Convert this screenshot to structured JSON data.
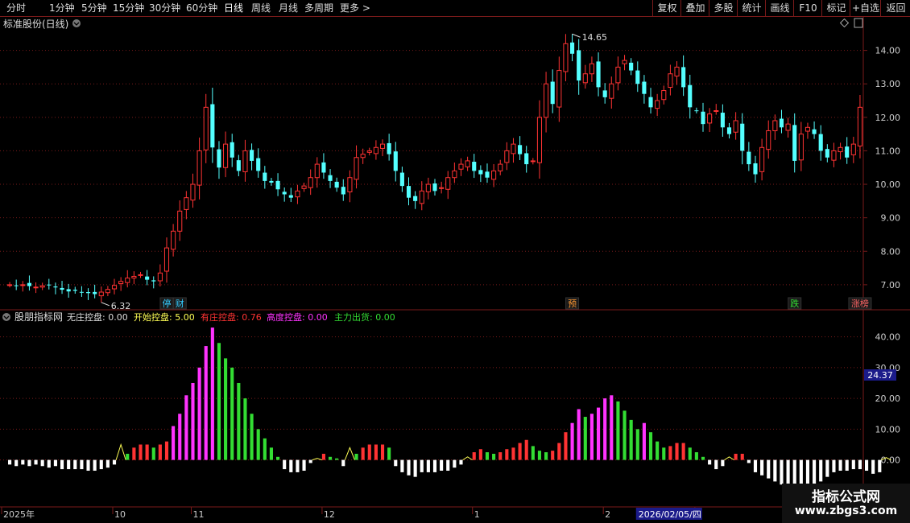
{
  "toolbar": {
    "periods": [
      "分时",
      "1分钟",
      "5分钟",
      "15分钟",
      "30分钟",
      "60分钟",
      "日线",
      "周线",
      "月线",
      "多周期",
      "更多 >"
    ],
    "active_period": "日线",
    "right_buttons": [
      "复权",
      "叠加",
      "多股",
      "统计",
      "画线",
      "F10",
      "标记",
      "+自选",
      "返回"
    ]
  },
  "main_panel": {
    "title": "标准股份(日线)",
    "high_label": "14.65",
    "low_label": "6.32",
    "markers": [
      {
        "idx": 24,
        "text": "停",
        "color": "#33ccff"
      },
      {
        "idx": 26,
        "text": "财",
        "color": "#33ccff"
      },
      {
        "idx": 86,
        "text": "预",
        "color": "#ff9933"
      },
      {
        "idx": 120,
        "text": "跌",
        "color": "#33dd33"
      },
      {
        "idx": 130,
        "text": "涨榜",
        "color": "#ff6666"
      }
    ]
  },
  "indicator_panel": {
    "title": "股朋指标网",
    "fields": [
      {
        "label": "无庄控盘: 0.00",
        "color": "#dddddd"
      },
      {
        "label": "开始控盘: 5.00",
        "color": "#ffff55"
      },
      {
        "label": "有庄控盘: 0.76",
        "color": "#ff3333"
      },
      {
        "label": "高度控盘: 0.00",
        "color": "#ff33ff"
      },
      {
        "label": "主力出货: 0.00",
        "color": "#33dd33"
      }
    ],
    "cursor_value": "24.37"
  },
  "time_axis": {
    "labels": [
      {
        "idx": 0,
        "text": "2025年"
      },
      {
        "idx": 16,
        "text": "10"
      },
      {
        "idx": 28,
        "text": "11"
      },
      {
        "idx": 48,
        "text": "12"
      },
      {
        "idx": 71,
        "text": "1"
      },
      {
        "idx": 91,
        "text": "2"
      },
      {
        "idx": 105,
        "text": "3"
      }
    ],
    "cursor_date": "2026/02/05/四",
    "cursor_idx": 96
  },
  "watermark": {
    "line1": "指标公式网",
    "line2": "www.zbgs3.com"
  },
  "colors": {
    "up": "#ff3333",
    "down": "#54ffff",
    "grid": "#7a1a1a",
    "magenta": "#ff33ff",
    "green": "#33dd33",
    "white": "#ffffff",
    "yellow": "#ffff55"
  },
  "chart_data": [
    {
      "type": "candlestick",
      "title": "标准股份(日线)",
      "ylim": [
        6.3,
        15.0
      ],
      "y_ticks": [
        7.0,
        8.0,
        9.0,
        10.0,
        11.0,
        12.0,
        13.0,
        14.0
      ],
      "close": [
        7.0,
        6.98,
        7.0,
        6.96,
        6.93,
        6.97,
        7.0,
        6.92,
        6.85,
        6.8,
        6.82,
        6.78,
        6.75,
        6.72,
        6.78,
        6.86,
        6.98,
        7.1,
        7.2,
        7.25,
        7.3,
        7.15,
        7.1,
        7.35,
        8.1,
        8.6,
        9.2,
        9.6,
        10.0,
        11.0,
        12.3,
        11.1,
        10.5,
        11.2,
        10.8,
        10.4,
        11.0,
        10.7,
        10.4,
        10.1,
        10.05,
        9.85,
        9.7,
        9.6,
        9.8,
        9.95,
        10.2,
        10.6,
        10.35,
        10.1,
        9.9,
        9.7,
        10.2,
        10.8,
        10.9,
        11.0,
        11.1,
        11.2,
        10.9,
        10.4,
        9.95,
        9.6,
        9.5,
        9.8,
        10.0,
        9.8,
        9.9,
        10.2,
        10.4,
        10.6,
        10.7,
        10.4,
        10.3,
        10.2,
        10.4,
        10.6,
        11.0,
        11.2,
        10.9,
        10.6,
        10.7,
        12.0,
        13.0,
        12.4,
        13.4,
        14.2,
        13.9,
        13.1,
        13.3,
        13.6,
        12.9,
        12.6,
        13.0,
        13.5,
        13.7,
        13.4,
        13.0,
        12.7,
        12.3,
        12.5,
        12.8,
        13.3,
        13.5,
        12.9,
        12.3,
        12.2,
        11.8,
        12.1,
        12.2,
        11.7,
        11.5,
        11.9,
        11.0,
        10.6,
        10.3,
        11.1,
        11.6,
        11.9,
        11.7,
        11.8,
        10.7,
        11.5,
        11.7,
        11.5,
        11.0,
        10.8,
        11.0,
        11.1,
        10.8,
        11.2,
        12.3
      ]
    },
    {
      "type": "bar",
      "title": "股朋指标网",
      "ylim": [
        -15,
        48
      ],
      "y_ticks": [
        0,
        10,
        20,
        30,
        40
      ],
      "values": [
        -1.5,
        -2,
        -1.5,
        -2,
        -1.5,
        -2,
        -2.5,
        -2,
        -3,
        -3,
        -3,
        -3,
        -3.5,
        -3.5,
        -3,
        -2.5,
        -1.5,
        5,
        2,
        4,
        5,
        5,
        4,
        5,
        6,
        11,
        15,
        21,
        25,
        30,
        37,
        43,
        38,
        33,
        30,
        25,
        20,
        15,
        10,
        7,
        4,
        1,
        -3,
        -4,
        -4,
        -3.5,
        -1,
        0.5,
        2,
        1,
        0.5,
        -2,
        4,
        2,
        4,
        5,
        5,
        5,
        4,
        -2,
        -4,
        -5,
        -5.5,
        -4,
        -4,
        -4,
        -3.5,
        -3.5,
        -2.5,
        -1.5,
        1,
        2.5,
        3.5,
        2.5,
        2,
        2.5,
        3.5,
        4,
        5.5,
        6.5,
        4.5,
        3,
        2.5,
        3,
        5.5,
        9,
        12,
        16.5,
        14,
        15,
        17,
        20,
        21,
        19,
        16,
        13,
        10,
        12,
        9,
        6,
        4,
        4.5,
        5.5,
        5.5,
        4,
        2.5,
        1,
        -1.5,
        -3,
        -2,
        1,
        2,
        2,
        -1,
        -4,
        -5,
        -6,
        -7,
        -8,
        -9.5,
        -12,
        -14,
        -13,
        -11,
        -7,
        -5.5,
        -4,
        -3.5,
        -3.5,
        -3,
        -3,
        -3.5,
        -4.5,
        -4,
        0.76
      ]
    }
  ]
}
